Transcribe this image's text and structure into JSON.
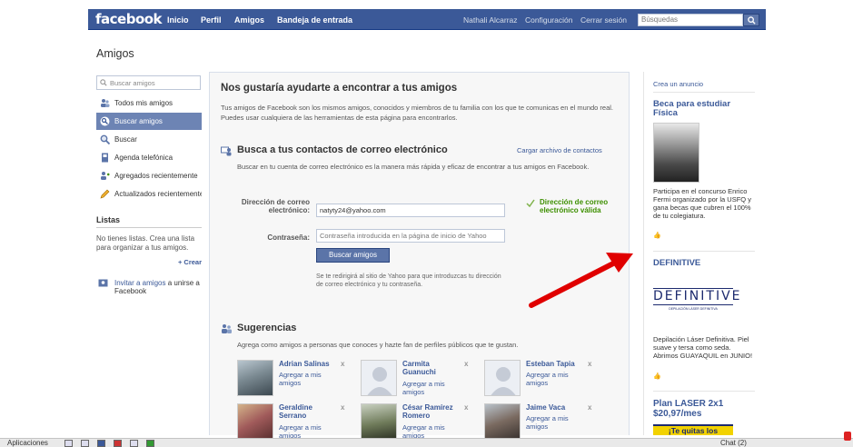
{
  "header": {
    "logo": "facebook",
    "nav": [
      "Inicio",
      "Perfil",
      "Amigos",
      "Bandeja de entrada"
    ],
    "user": "Nathali Alcarraz",
    "settings": "Configuración",
    "logout": "Cerrar sesión",
    "search_placeholder": "Búsquedas",
    "colors": {
      "bar": "#3b5998",
      "accent": "#6d84b4"
    }
  },
  "page": {
    "title": "Amigos"
  },
  "sidebar": {
    "search_placeholder": "Buscar amigos",
    "items": [
      {
        "label": "Todos mis amigos",
        "icon": "friends-icon",
        "selected": false
      },
      {
        "label": "Buscar amigos",
        "icon": "find-friends-icon",
        "selected": true
      },
      {
        "label": "Buscar",
        "icon": "search-icon",
        "selected": false
      },
      {
        "label": "Agenda telefónica",
        "icon": "phonebook-icon",
        "selected": false
      },
      {
        "label": "Agregados recientemente",
        "icon": "recent-friends-icon",
        "selected": false
      },
      {
        "label": "Actualizados recientemente",
        "icon": "pencil-icon",
        "selected": false
      }
    ],
    "lists_title": "Listas",
    "lists_text": "No tienes listas. Crea una lista para organizar a tus amigos.",
    "create_label": "+ Crear",
    "invite_link": "Invitar a amigos",
    "invite_text": " a unirse a Facebook"
  },
  "main": {
    "title": "Nos gustaría ayudarte a encontrar a tus amigos",
    "desc": "Tus amigos de Facebook son los mismos amigos, conocidos y miembros de tu familia con los que te comunicas en el mundo real. Puedes usar cualquiera de las herramientas de esta página para encontrarlos.",
    "email_section": {
      "title": "Busca a tus contactos de correo electrónico",
      "upload_link": "Cargar archivo de contactos",
      "desc": "Buscar en tu cuenta de correo electrónico es la manera más rápida y eficaz de encontrar a tus amigos en Facebook.",
      "email_label": "Dirección de correo electrónico:",
      "email_value": "natyty24@yahoo.com",
      "valid_text": "Dirección de correo electrónico válida",
      "password_label": "Contraseña:",
      "password_placeholder": "Contraseña introducida en la página de inicio de Yahoo",
      "button": "Buscar amigos",
      "note": "Se te redirigirá al sitio de Yahoo para que introduzcas tu dirección de correo electrónico y tu contraseña."
    },
    "suggestions": {
      "title": "Sugerencias",
      "desc": "Agrega como amigos a personas que conoces y hazte fan de perfiles públicos que te gustan.",
      "add_label": "Agregar a mis amigos",
      "close": "x",
      "people": [
        "Adrian Salinas",
        "Carmita Guanuchi",
        "Esteban Tapia",
        "Geraldine Serrano",
        "César Ramírez Romero",
        "Jaime Vaca"
      ]
    }
  },
  "ads": {
    "create_ad": "Crea un anuncio",
    "ad1": {
      "title": "Beca para estudiar Física",
      "body": "Participa en el concurso Enrico Fermi organizado por la USFQ y gana becas que cubren el 100% de tu colegiatura."
    },
    "ad2": {
      "title": "DEFINITIVE",
      "logo": "DEFINITIVE",
      "logo_sub": "DEPILACIÓN LÁSER DEFINITIVA",
      "body": "Depilación Láser Definitiva. Piel suave y tersa como seda. Abrimos GUAYAQUIL en JUNIO!"
    },
    "ad3": {
      "title": "Plan LASER 2x1 $20,97/mes",
      "banner": "¡Te quitas los"
    }
  },
  "taskbar": {
    "label": "Aplicaciones",
    "chat": "Chat (2)"
  }
}
